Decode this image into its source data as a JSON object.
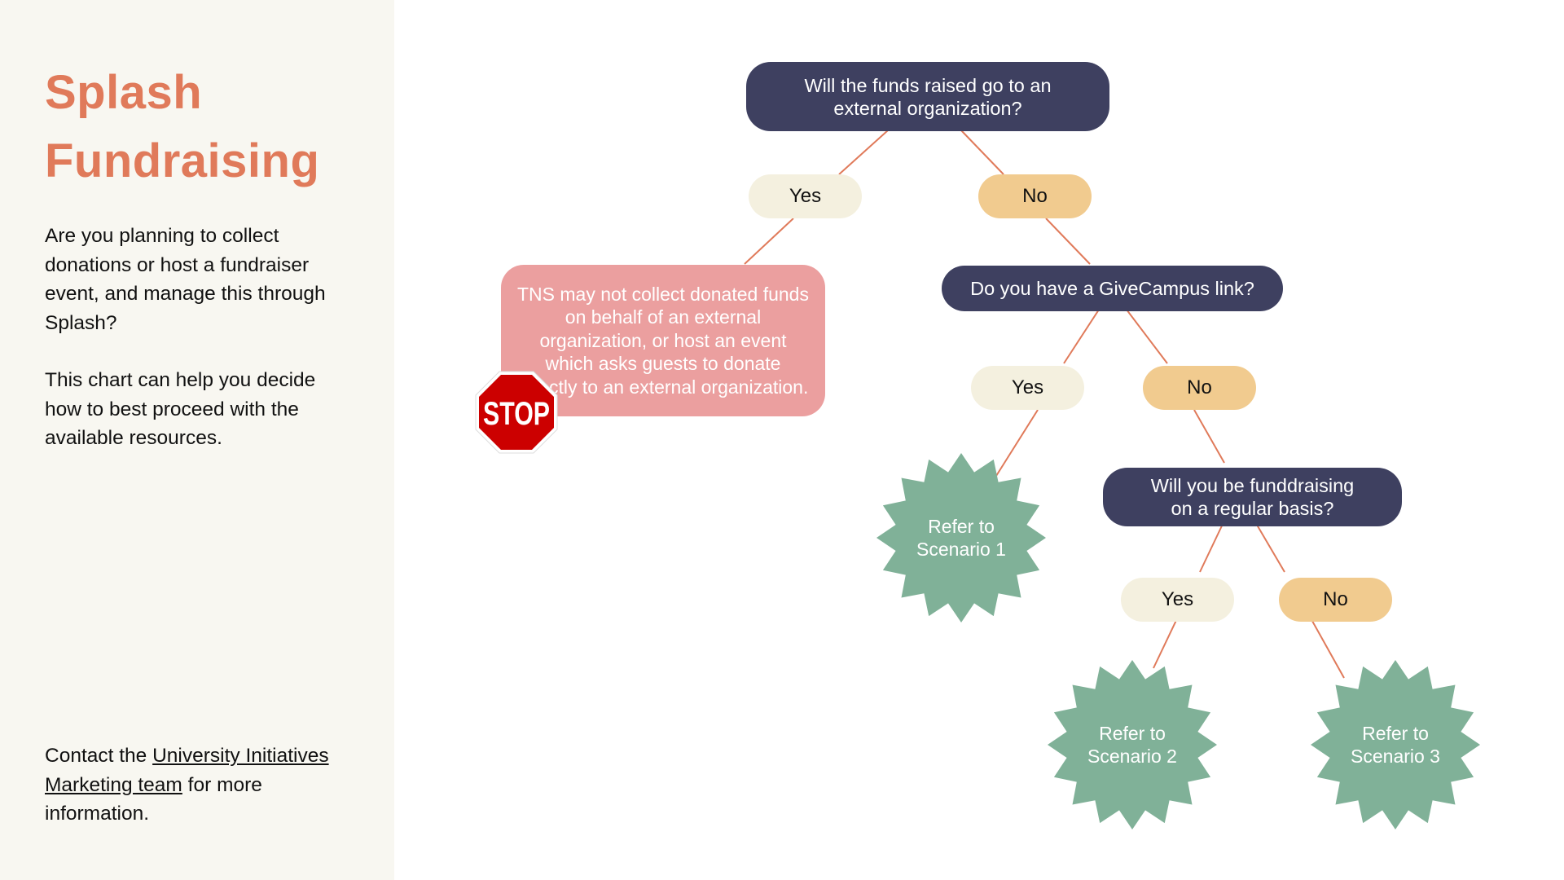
{
  "sidebar": {
    "title_line1": "Splash",
    "title_line2": "Fundraising",
    "intro_p1": "Are you planning to collect donations or host a fundraiser event, and manage this through Splash?",
    "intro_p2": "This chart can help you decide how to best proceed with the available resources.",
    "contact_prefix": "Contact the ",
    "contact_link": "University Initiatives Marketing team",
    "contact_suffix": " for more information."
  },
  "flowchart": {
    "q1": "Will the funds raised go to an external organization?",
    "q1_yes": "Yes",
    "q1_no": "No",
    "stop_message": "TNS may not collect donated funds on behalf of an external organization, or host an event which asks guests to donate directly to an external organization.",
    "stop_sign_text": "STOP",
    "q2": "Do you have a GiveCampus link?",
    "q2_yes": "Yes",
    "q2_no": "No",
    "result1": "Refer to Scenario 1",
    "q3": "Will you be funddraising on a regular basis?",
    "q3_yes": "Yes",
    "q3_no": "No",
    "result2": "Refer to Scenario 2",
    "result3": "Refer to Scenario 3"
  },
  "colors": {
    "accent": "#E07A5A",
    "question": "#3E4060",
    "yes": "#F4F0DF",
    "no": "#F1CB8F",
    "stop_box": "#EB9F9F",
    "result": "#80B198",
    "stop_sign": "#CC0000"
  }
}
